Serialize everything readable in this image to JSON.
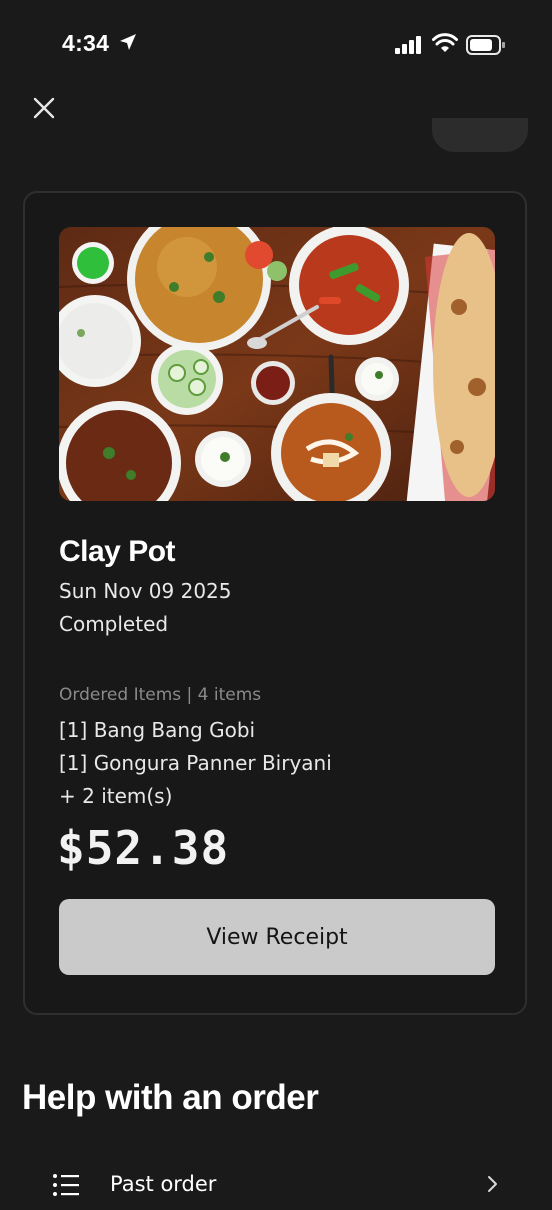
{
  "status_bar": {
    "time": "4:34"
  },
  "order": {
    "restaurant": "Clay Pot",
    "date": "Sun Nov 09 2025",
    "status": "Completed",
    "items_header": "Ordered Items | 4 items",
    "items": [
      "[1] Bang Bang Gobi",
      "[1] Gongura Panner Biryani",
      "+ 2 item(s)"
    ],
    "total": "$52.38",
    "receipt_button": "View Receipt"
  },
  "help": {
    "title": "Help with an order",
    "rows": [
      {
        "label": "Past order",
        "icon": "list-icon"
      }
    ]
  },
  "icons": [
    "location-arrow-icon",
    "signal-icon",
    "wifi-icon",
    "battery-icon",
    "close-icon",
    "list-icon",
    "chevron-right-icon"
  ],
  "colors": {
    "background": "#1a1a1a",
    "card_border": "#2f2f2f",
    "button_bg": "#cacaca",
    "muted_text": "#8a8a8a"
  }
}
